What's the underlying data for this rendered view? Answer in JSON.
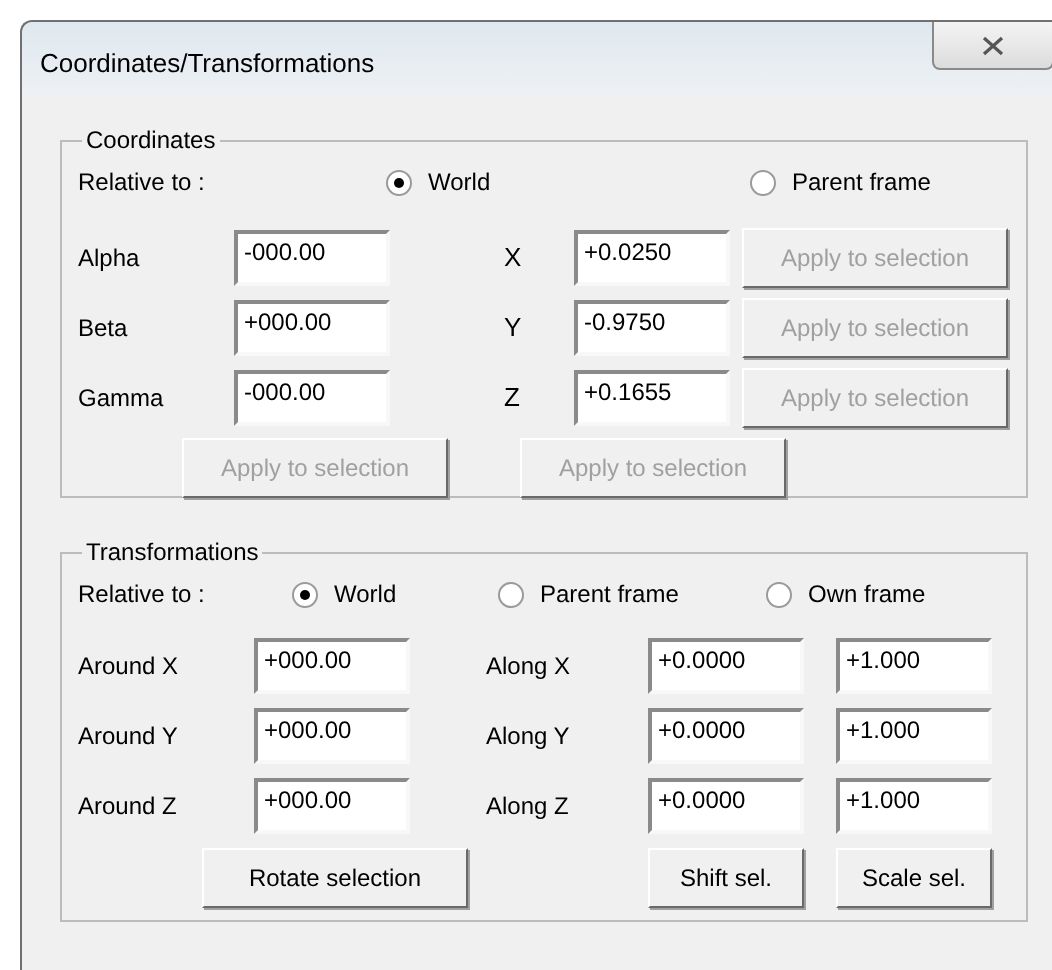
{
  "window": {
    "title": "Coordinates/Transformations"
  },
  "coordinates": {
    "title": "Coordinates",
    "relative_label": "Relative to :",
    "options": [
      {
        "label": "World",
        "selected": true
      },
      {
        "label": "Parent frame",
        "selected": false
      }
    ],
    "rows": [
      {
        "angle_label": "Alpha",
        "angle_value": "-000.00",
        "axis_label": "X",
        "axis_value": "+0.0250",
        "button": {
          "label": "Apply to selection",
          "disabled": true
        }
      },
      {
        "angle_label": "Beta",
        "angle_value": "+000.00",
        "axis_label": "Y",
        "axis_value": "-0.9750",
        "button": {
          "label": "Apply to selection",
          "disabled": true
        }
      },
      {
        "angle_label": "Gamma",
        "angle_value": "-000.00",
        "axis_label": "Z",
        "axis_value": "+0.1655",
        "button": {
          "label": "Apply to selection",
          "disabled": true
        }
      }
    ],
    "buttons": [
      {
        "label": "Apply to selection",
        "disabled": true
      },
      {
        "label": "Apply to selection",
        "disabled": true
      }
    ]
  },
  "transformations": {
    "title": "Transformations",
    "relative_label": "Relative to :",
    "options": [
      {
        "label": "World",
        "selected": true
      },
      {
        "label": "Parent frame",
        "selected": false
      },
      {
        "label": "Own frame",
        "selected": false
      }
    ],
    "rows": [
      {
        "rotate_label": "Around X",
        "rotate_value": "+000.00",
        "shift_label": "Along X",
        "shift_value": "+0.0000",
        "scale_value": "+1.000"
      },
      {
        "rotate_label": "Around Y",
        "rotate_value": "+000.00",
        "shift_label": "Along Y",
        "shift_value": "+0.0000",
        "scale_value": "+1.000"
      },
      {
        "rotate_label": "Around Z",
        "rotate_value": "+000.00",
        "shift_label": "Along Z",
        "shift_value": "+0.0000",
        "scale_value": "+1.000"
      }
    ],
    "buttons": [
      {
        "label": "Rotate selection",
        "disabled": false
      },
      {
        "label": "Shift sel.",
        "disabled": false
      },
      {
        "label": "Scale sel.",
        "disabled": false
      }
    ]
  }
}
